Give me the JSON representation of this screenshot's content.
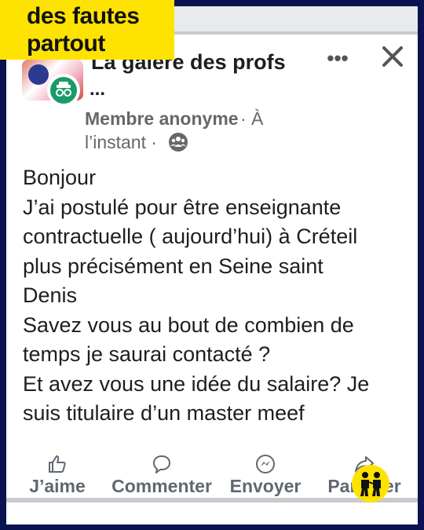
{
  "banner": {
    "line1": "des fautes",
    "line2": "partout"
  },
  "post": {
    "group_name": "La galère des profs",
    "group_ellipsis": "...",
    "author": "Membre anonyme",
    "author_separator": "· À",
    "time": "l’instant ·",
    "lines": [
      "Bonjour",
      "J’ai postulé pour être enseignante",
      "contractuelle ( aujourd’hui) à Créteil",
      "plus précisément en Seine saint",
      "Denis",
      "Savez vous au bout de combien de",
      "temps je saurai contacté ?",
      "Et avez vous une idée du salaire? Je",
      "suis titulaire d’un master meef"
    ]
  },
  "header": {
    "more_label": "•••"
  },
  "actions": {
    "like": "J’aime",
    "comment": "Commenter",
    "send": "Envoyer",
    "share": "Partager"
  },
  "icons": {
    "more": "more-options-icon",
    "close": "close-icon",
    "audience": "audience-group-icon",
    "like": "thumbs-up-icon",
    "comment": "comment-bubble-icon",
    "send": "messenger-icon",
    "share": "share-arrow-icon",
    "anonymous": "anonymous-incognito-icon"
  },
  "colors": {
    "banner": "#ffe300",
    "frame": "#0b1450",
    "text": "#1c1e21",
    "secondary": "#65676b",
    "anon_badge": "#1b9a6b"
  }
}
